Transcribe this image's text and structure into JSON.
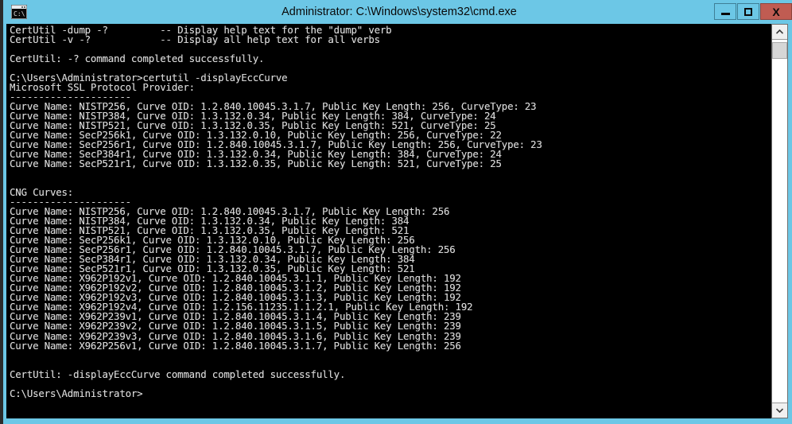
{
  "window": {
    "title": "Administrator: C:\\Windows\\system32\\cmd.exe",
    "icon": "cmd-console-icon",
    "titlebar_color": "#6cc7e6",
    "close_button_color": "#c05c52",
    "console_bg": "#000000",
    "console_fg": "#d4d4d4",
    "controls": {
      "minimize_label": "–",
      "maximize_label": "□",
      "close_label": "X"
    }
  },
  "console": {
    "lines": [
      "CertUtil -dump -?         -- Display help text for the \"dump\" verb",
      "CertUtil -v -?            -- Display all help text for all verbs",
      "",
      "CertUtil: -? command completed successfully.",
      "",
      "C:\\Users\\Administrator>certutil -displayEccCurve",
      "Microsoft SSL Protocol Provider:",
      "---------------------",
      "Curve Name: NISTP256, Curve OID: 1.2.840.10045.3.1.7, Public Key Length: 256, CurveType: 23",
      "Curve Name: NISTP384, Curve OID: 1.3.132.0.34, Public Key Length: 384, CurveType: 24",
      "Curve Name: NISTP521, Curve OID: 1.3.132.0.35, Public Key Length: 521, CurveType: 25",
      "Curve Name: SecP256k1, Curve OID: 1.3.132.0.10, Public Key Length: 256, CurveType: 22",
      "Curve Name: SecP256r1, Curve OID: 1.2.840.10045.3.1.7, Public Key Length: 256, CurveType: 23",
      "Curve Name: SecP384r1, Curve OID: 1.3.132.0.34, Public Key Length: 384, CurveType: 24",
      "Curve Name: SecP521r1, Curve OID: 1.3.132.0.35, Public Key Length: 521, CurveType: 25",
      "",
      "",
      "CNG Curves:",
      "---------------------",
      "Curve Name: NISTP256, Curve OID: 1.2.840.10045.3.1.7, Public Key Length: 256",
      "Curve Name: NISTP384, Curve OID: 1.3.132.0.34, Public Key Length: 384",
      "Curve Name: NISTP521, Curve OID: 1.3.132.0.35, Public Key Length: 521",
      "Curve Name: SecP256k1, Curve OID: 1.3.132.0.10, Public Key Length: 256",
      "Curve Name: SecP256r1, Curve OID: 1.2.840.10045.3.1.7, Public Key Length: 256",
      "Curve Name: SecP384r1, Curve OID: 1.3.132.0.34, Public Key Length: 384",
      "Curve Name: SecP521r1, Curve OID: 1.3.132.0.35, Public Key Length: 521",
      "Curve Name: X962P192v1, Curve OID: 1.2.840.10045.3.1.1, Public Key Length: 192",
      "Curve Name: X962P192v2, Curve OID: 1.2.840.10045.3.1.2, Public Key Length: 192",
      "Curve Name: X962P192v3, Curve OID: 1.2.840.10045.3.1.3, Public Key Length: 192",
      "Curve Name: X962P192v4, Curve OID: 1.2.156.11235.1.1.2.1, Public Key Length: 192",
      "Curve Name: X962P239v1, Curve OID: 1.2.840.10045.3.1.4, Public Key Length: 239",
      "Curve Name: X962P239v2, Curve OID: 1.2.840.10045.3.1.5, Public Key Length: 239",
      "Curve Name: X962P239v3, Curve OID: 1.2.840.10045.3.1.6, Public Key Length: 239",
      "Curve Name: X962P256v1, Curve OID: 1.2.840.10045.3.1.7, Public Key Length: 256",
      "",
      "",
      "CertUtil: -displayEccCurve command completed successfully.",
      "",
      "C:\\Users\\Administrator>"
    ]
  },
  "scrollbar": {
    "up_arrow": "scroll-up",
    "down_arrow": "scroll-down",
    "thumb": "scroll-thumb"
  }
}
